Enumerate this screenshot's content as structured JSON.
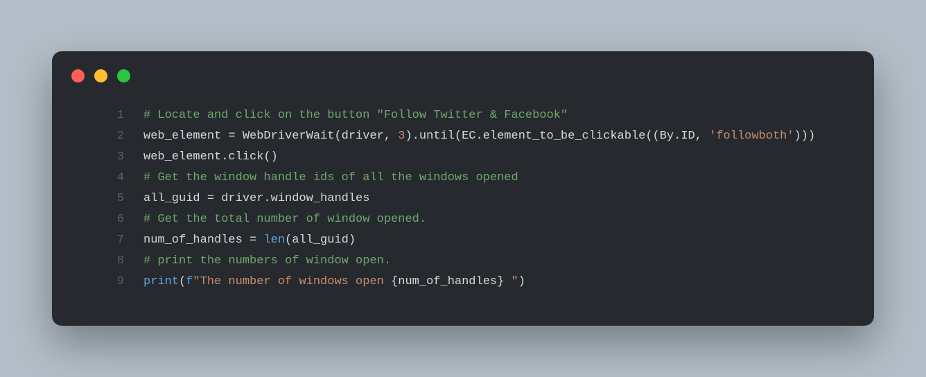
{
  "window": {
    "dots": {
      "close": "#ff5f57",
      "min": "#febc2e",
      "max": "#28c840"
    }
  },
  "code": {
    "line_numbers": [
      "1",
      "2",
      "3",
      "4",
      "5",
      "6",
      "7",
      "8",
      "9"
    ],
    "l1_comment": "# Locate and click on the button \"Follow Twitter & Facebook\"",
    "l2_a": "web_element = WebDriverWait(driver, ",
    "l2_num": "3",
    "l2_b": ").until(EC.element_to_be_clickable((By.ID, ",
    "l2_str": "'followboth'",
    "l2_c": ")))",
    "l3": "web_element.click()",
    "l4_comment": "# Get the window handle ids of all the windows opened",
    "l5": "all_guid = driver.window_handles",
    "l6_comment": "# Get the total number of window opened.",
    "l7_a": "num_of_handles = ",
    "l7_len": "len",
    "l7_b": "(all_guid)",
    "l8_comment": "# print the numbers of window open.",
    "l9_a": "print",
    "l9_b": "(",
    "l9_f": "f",
    "l9_str_a": "\"The number of windows open ",
    "l9_interp": "{num_of_handles}",
    "l9_str_b": " \"",
    "l9_c": ")"
  }
}
